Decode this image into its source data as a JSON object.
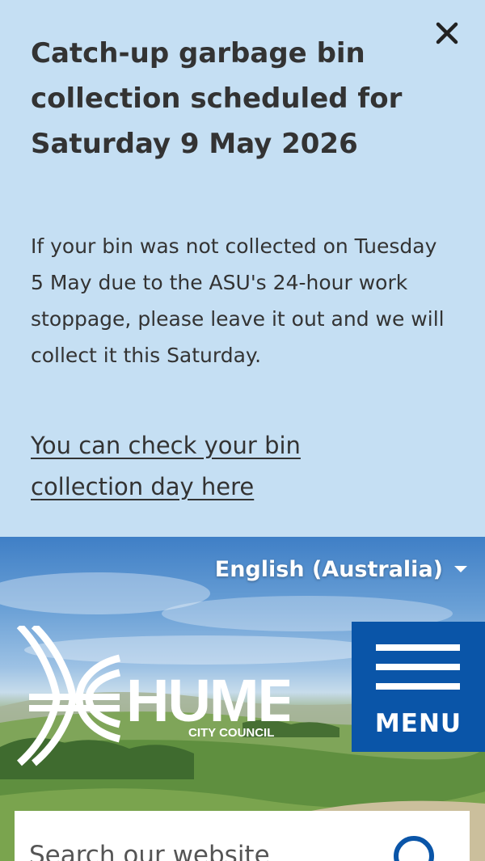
{
  "alert": {
    "title": "Catch-up garbage bin collection scheduled for Saturday 9 May 2026",
    "body": "If your bin was not collected on Tuesday 5 May due to the ASU's 24-hour work stoppage, please leave it out and we will collect it this Saturday.",
    "link_text": "You can check your bin collection day here",
    "close_icon": "close-icon",
    "background": "#c5dff3"
  },
  "header": {
    "language": "English (Australia)",
    "logo": {
      "name": "HUME",
      "subtitle": "CITY COUNCIL"
    },
    "menu_label": "MENU",
    "brand_color": "#0a55a8"
  },
  "search": {
    "placeholder": "Search our website",
    "icon": "search-icon"
  }
}
